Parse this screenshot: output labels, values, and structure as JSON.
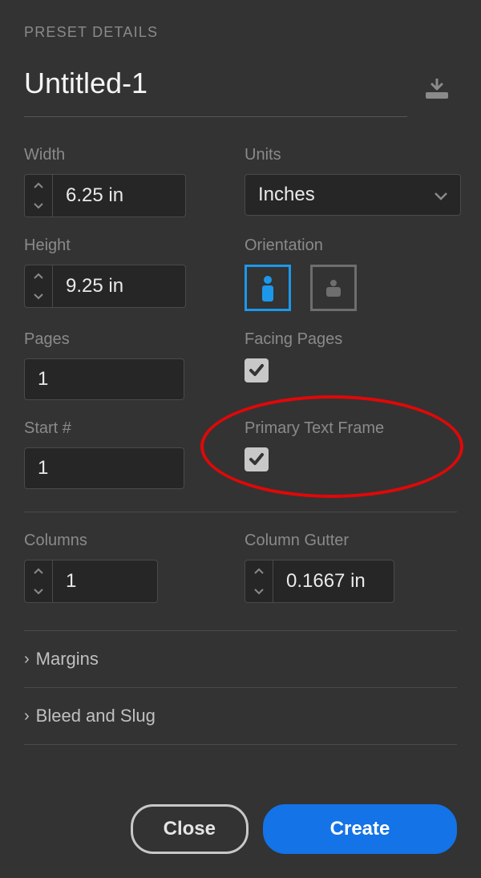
{
  "header": {
    "section_title": "PRESET DETAILS",
    "doc_title": "Untitled-1"
  },
  "labels": {
    "width": "Width",
    "units": "Units",
    "height": "Height",
    "orientation": "Orientation",
    "pages": "Pages",
    "facing_pages": "Facing Pages",
    "start_no": "Start #",
    "primary_text_frame": "Primary Text Frame",
    "columns": "Columns",
    "column_gutter": "Column Gutter",
    "margins": "Margins",
    "bleed_slug": "Bleed and Slug"
  },
  "values": {
    "width": "6.25 in",
    "height": "9.25 in",
    "units": "Inches",
    "pages": "1",
    "start_no": "1",
    "columns": "1",
    "column_gutter": "0.1667 in",
    "facing_pages": true,
    "primary_text_frame": true,
    "orientation": "portrait"
  },
  "buttons": {
    "close": "Close",
    "create": "Create"
  },
  "annotation": {
    "target": "primary_text_frame"
  }
}
